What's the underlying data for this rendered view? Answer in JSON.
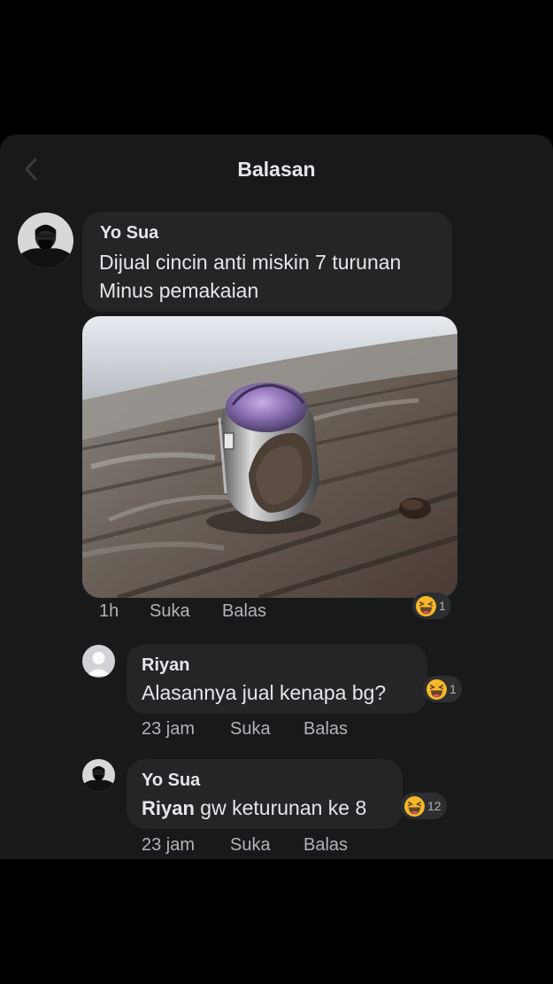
{
  "header": {
    "title": "Balasan"
  },
  "post": {
    "author": "Yo Sua",
    "line1": "Dijual cincin anti miskin 7 turunan",
    "line2": "Minus pemakaian",
    "time": "1h",
    "like": "Suka",
    "reply": "Balas",
    "reaction_count": "1"
  },
  "replies": [
    {
      "author": "Riyan",
      "text": "Alasannya jual kenapa bg?",
      "time": "23 jam",
      "like": "Suka",
      "reply": "Balas",
      "reaction_count": "1"
    },
    {
      "author": "Yo Sua",
      "mention": "Riyan",
      "text": " gw keturunan ke 8",
      "time": "23 jam",
      "like": "Suka",
      "reply": "Balas",
      "reaction_count": "12"
    }
  ],
  "colors": {
    "page": "#000000",
    "panel": "#18191a",
    "bubble": "#242526",
    "text": "#e4e6eb",
    "secondary": "#b0b3b8",
    "reaction": "#f7b928"
  },
  "icons": [
    "back-arrow-icon",
    "haha-reaction-icon",
    "default-avatar-icon"
  ]
}
